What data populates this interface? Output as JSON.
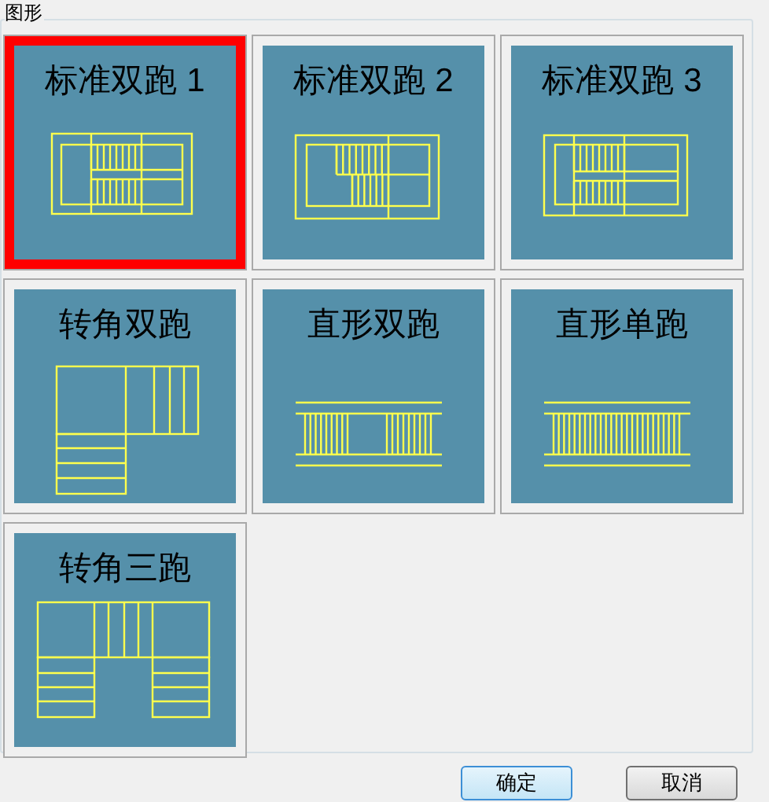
{
  "group": {
    "label": "图形"
  },
  "tiles": [
    {
      "label": "标准双跑 1",
      "kind": "std1",
      "selected": true
    },
    {
      "label": "标准双跑 2",
      "kind": "std2",
      "selected": false
    },
    {
      "label": "标准双跑 3",
      "kind": "std3",
      "selected": false
    },
    {
      "label": "转角双跑",
      "kind": "corner2",
      "selected": false
    },
    {
      "label": "直形双跑",
      "kind": "straight2",
      "selected": false
    },
    {
      "label": "直形单跑",
      "kind": "straight1",
      "selected": false
    },
    {
      "label": "转角三跑",
      "kind": "corner3",
      "selected": false
    }
  ],
  "buttons": [
    {
      "label": "确定",
      "default": true
    },
    {
      "label": "取消",
      "default": false
    }
  ]
}
